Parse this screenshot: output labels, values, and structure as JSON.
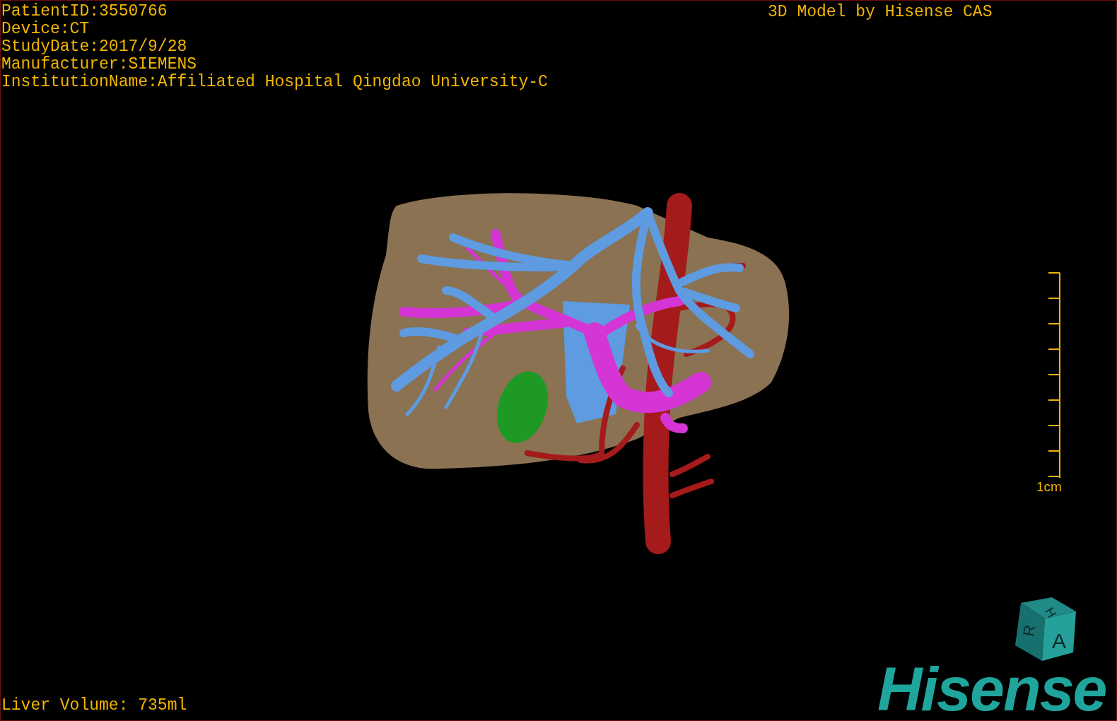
{
  "patient_info": [
    "PatientID:3550766",
    "Device:CT",
    "StudyDate:2017/9/28",
    "Manufacturer:SIEMENS",
    "InstitutionName:Affiliated Hospital Qingdao University-C"
  ],
  "model_credit": "3D Model by Hisense CAS",
  "scale_bar": {
    "label": "1cm"
  },
  "orientation_cube": {
    "faces": [
      "H",
      "R",
      "A"
    ]
  },
  "liver_volume": "Liver Volume: 735ml",
  "logo": "Hisense"
}
